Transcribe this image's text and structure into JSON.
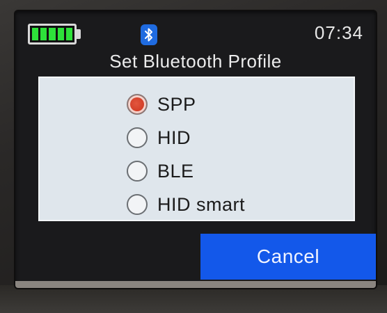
{
  "status": {
    "battery_icon": "battery-full-icon",
    "bluetooth_icon": "bluetooth-icon",
    "time": "07:34",
    "colors": {
      "battery": "#2ee23a",
      "bluetooth": "#1f6be0"
    }
  },
  "dialog": {
    "title": "Set Bluetooth Profile",
    "options": [
      {
        "label": "SPP",
        "selected": true
      },
      {
        "label": "HID",
        "selected": false
      },
      {
        "label": "BLE",
        "selected": false
      },
      {
        "label": "HID smart",
        "selected": false
      }
    ],
    "cancel_label": "Cancel",
    "colors": {
      "selected_radio": "#d23c26",
      "cancel_button": "#1358ea",
      "panel": "#dfe6ec"
    }
  }
}
